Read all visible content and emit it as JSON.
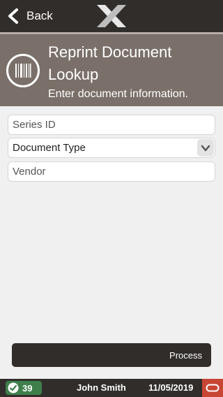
{
  "nav": {
    "back_label": "Back"
  },
  "header": {
    "title": "Reprint Document Lookup",
    "subtitle": "Enter document information."
  },
  "form": {
    "series_id_placeholder": "Series ID",
    "document_type_label": "Document Type",
    "vendor_placeholder": "Vendor"
  },
  "actions": {
    "process_label": "Process"
  },
  "status": {
    "count": "39",
    "user": "John Smith",
    "date": "11/05/2019"
  },
  "icons": {
    "back": "chevron-left-icon",
    "logo": "x-logo",
    "header": "barcode-icon",
    "select": "chevron-down-icon",
    "status": "check-icon",
    "brand": "oracle-icon"
  },
  "colors": {
    "topbar": "#312d2a",
    "header": "#7a7069",
    "status_green": "#3f7f4c",
    "oracle_red": "#c74634"
  }
}
